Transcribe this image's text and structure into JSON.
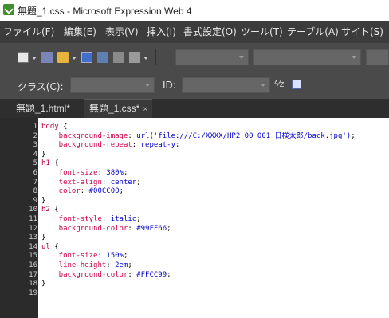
{
  "window": {
    "title": "無題_1.css - Microsoft Expression Web 4"
  },
  "menu": [
    "ファイル(F)",
    "編集(E)",
    "表示(V)",
    "挿入(I)",
    "書式設定(O)",
    "ツール(T)",
    "テーブル(A)",
    "サイト(S)"
  ],
  "classbar": {
    "class_label": "クラス(C):",
    "id_label": "ID:"
  },
  "tabs": [
    {
      "label": "無題_1.html*",
      "active": false
    },
    {
      "label": "無題_1.css*",
      "active": true,
      "close": "×"
    }
  ],
  "code_lines": [
    {
      "n": "1",
      "parts": [
        [
          "sel",
          "body"
        ],
        [
          "brace",
          " {"
        ]
      ]
    },
    {
      "n": "2",
      "parts": [
        [
          "prop",
          "    background-image"
        ],
        [
          "punct",
          ": "
        ],
        [
          "val",
          "url('file:///C:/XXXX/HP2_00_001_日検太郎/back.jpg')"
        ],
        [
          "punct",
          ";"
        ]
      ]
    },
    {
      "n": "3",
      "parts": [
        [
          "prop",
          "    background-repeat"
        ],
        [
          "punct",
          ": "
        ],
        [
          "val",
          "repeat-y"
        ],
        [
          "punct",
          ";"
        ]
      ]
    },
    {
      "n": "4",
      "parts": [
        [
          "brace",
          "}"
        ]
      ]
    },
    {
      "n": "5",
      "parts": [
        [
          "sel",
          "h1"
        ],
        [
          "brace",
          " {"
        ]
      ]
    },
    {
      "n": "6",
      "parts": [
        [
          "prop",
          "    font-size"
        ],
        [
          "punct",
          ": "
        ],
        [
          "val",
          "380%"
        ],
        [
          "punct",
          ";"
        ]
      ]
    },
    {
      "n": "7",
      "parts": [
        [
          "prop",
          "    text-align"
        ],
        [
          "punct",
          ": "
        ],
        [
          "val",
          "center"
        ],
        [
          "punct",
          ";"
        ]
      ]
    },
    {
      "n": "8",
      "parts": [
        [
          "prop",
          "    color"
        ],
        [
          "punct",
          ": "
        ],
        [
          "val",
          "#00CC00"
        ],
        [
          "punct",
          ";"
        ]
      ]
    },
    {
      "n": "9",
      "parts": [
        [
          "brace",
          "}"
        ]
      ]
    },
    {
      "n": "10",
      "parts": [
        [
          "sel",
          "h2"
        ],
        [
          "brace",
          " {"
        ]
      ]
    },
    {
      "n": "11",
      "parts": [
        [
          "prop",
          "    font-style"
        ],
        [
          "punct",
          ": "
        ],
        [
          "val",
          "italic"
        ],
        [
          "punct",
          ";"
        ]
      ]
    },
    {
      "n": "12",
      "parts": [
        [
          "prop",
          "    background-color"
        ],
        [
          "punct",
          ": "
        ],
        [
          "val",
          "#99FF66"
        ],
        [
          "punct",
          ";"
        ]
      ]
    },
    {
      "n": "13",
      "parts": [
        [
          "brace",
          "}"
        ]
      ]
    },
    {
      "n": "14",
      "parts": [
        [
          "sel",
          "ul"
        ],
        [
          "brace",
          " {"
        ]
      ]
    },
    {
      "n": "15",
      "parts": [
        [
          "prop",
          "    font-size"
        ],
        [
          "punct",
          ": "
        ],
        [
          "val",
          "150%"
        ],
        [
          "punct",
          ";"
        ]
      ]
    },
    {
      "n": "16",
      "parts": [
        [
          "prop",
          "    line-height"
        ],
        [
          "punct",
          ": "
        ],
        [
          "val",
          "2em"
        ],
        [
          "punct",
          ";"
        ]
      ]
    },
    {
      "n": "17",
      "parts": [
        [
          "prop",
          "    background-color"
        ],
        [
          "punct",
          ": "
        ],
        [
          "val",
          "#FFCC99"
        ],
        [
          "punct",
          ";"
        ]
      ]
    },
    {
      "n": "18",
      "parts": [
        [
          "brace",
          "}"
        ]
      ]
    },
    {
      "n": "19",
      "parts": []
    }
  ]
}
